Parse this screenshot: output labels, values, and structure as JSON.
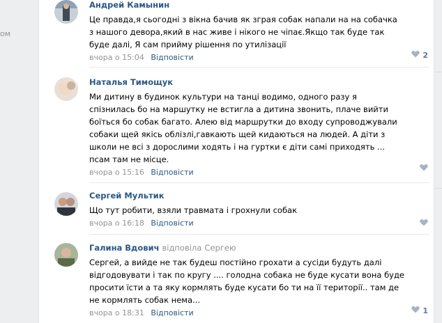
{
  "sidebar_fragment": "ом",
  "comments": [
    {
      "author": "Андрей Камынин",
      "replied_label": "",
      "replied_to": "",
      "lines": [
        "Це правда,я сьогодні з вікна бачив як зграя собак напали на на собачка",
        "з нашого девора,який в нас живе і нікого не чіпає.Якщо так буде так",
        "буде далі, Я сам прийму рішення по утилізації"
      ],
      "time": "вчора о 15:04",
      "reply": "Відповісти",
      "likes": "2",
      "avatar_icon": "user-avatar"
    },
    {
      "author": "Наталья Тимощук",
      "replied_label": "",
      "replied_to": "",
      "lines": [
        "Ми дитину в будинок культури на танці водимо, одного разу я",
        "спізнилась бо на маршутку не встигла а дитина звонить, плаче вийти",
        "боїться бо собак багато. Алею від маршрутки до входу супроводжували",
        "собаки щей якісь облізлі,гавкають щей кидаються на людей. А діти з",
        "школи не всі з дорослими ходять і на гуртки є діти самі приходять ...",
        "псам там не місце."
      ],
      "time": "вчора о 15:16",
      "reply": "Відповісти",
      "likes": "",
      "avatar_icon": "user-avatar"
    },
    {
      "author": "Сергей Мультик",
      "replied_label": "",
      "replied_to": "",
      "lines": [
        "Що тут робити, взяли травмата і грохнули собак"
      ],
      "time": "вчора о 16:18",
      "reply": "Відповісти",
      "likes": "",
      "avatar_icon": "user-avatar"
    },
    {
      "author": "Галина Вдович",
      "replied_label": "відповіла",
      "replied_to": "Сергею",
      "lines": [
        "Сергей, а вийде не так будеш постійно грохати а сусіди будуть далі",
        "відгодовувати і так по кругу .... голодна собака не буде кусати вона буде",
        "просити їсти а та яку кормлять буде кусати бо ти на її території.. там де",
        "не кормлять собак нема..."
      ],
      "time": "вчора о 18:31",
      "reply": "Відповісти",
      "likes": "1",
      "avatar_icon": "user-avatar"
    }
  ],
  "colors": {
    "link": "#2a5885",
    "meta": "#939393",
    "like_icon": "#a7b3c2",
    "background": "#edeef0"
  }
}
